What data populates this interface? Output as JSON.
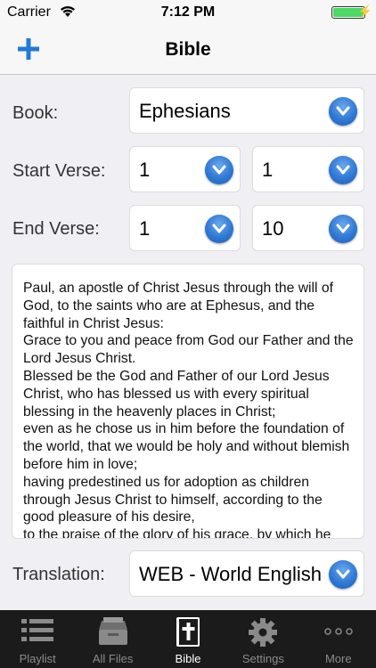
{
  "status": {
    "carrier": "Carrier",
    "time": "7:12 PM"
  },
  "nav": {
    "title": "Bible",
    "add_icon": "plus-icon"
  },
  "form": {
    "book_label": "Book:",
    "book_value": "Ephesians",
    "start_label": "Start Verse:",
    "start_chapter": "1",
    "start_verse": "1",
    "end_label": "End Verse:",
    "end_chapter": "1",
    "end_verse": "10",
    "translation_label": "Translation:",
    "translation_value": "WEB - World English"
  },
  "passage": "Paul, an apostle of Christ Jesus through the will of God, to the saints who are at Ephesus, and the faithful in Christ Jesus:\nGrace to you and peace from God our Father and the Lord Jesus Christ.\nBlessed be the God and Father of our Lord Jesus Christ, who has blessed us with every spiritual blessing in the heavenly places in Christ;\neven as he chose us in him before the foundation of the world, that we would be holy and without blemish before him in love;\nhaving predestined us for adoption as children through Jesus Christ to himself, according to the good pleasure of his desire,\nto the praise of the glory of his grace, by which he freely bestowed favor on us in the Beloved,",
  "tabs": [
    {
      "label": "Playlist",
      "icon": "list-icon",
      "active": false
    },
    {
      "label": "All Files",
      "icon": "archive-box-icon",
      "active": false
    },
    {
      "label": "Bible",
      "icon": "bible-icon",
      "active": true
    },
    {
      "label": "Settings",
      "icon": "gear-icon",
      "active": false
    },
    {
      "label": "More",
      "icon": "more-dots-icon",
      "active": false
    }
  ],
  "colors": {
    "accent": "#1f7bd8",
    "battery": "#4cd964",
    "tab_bar": "#1b1b1b"
  }
}
